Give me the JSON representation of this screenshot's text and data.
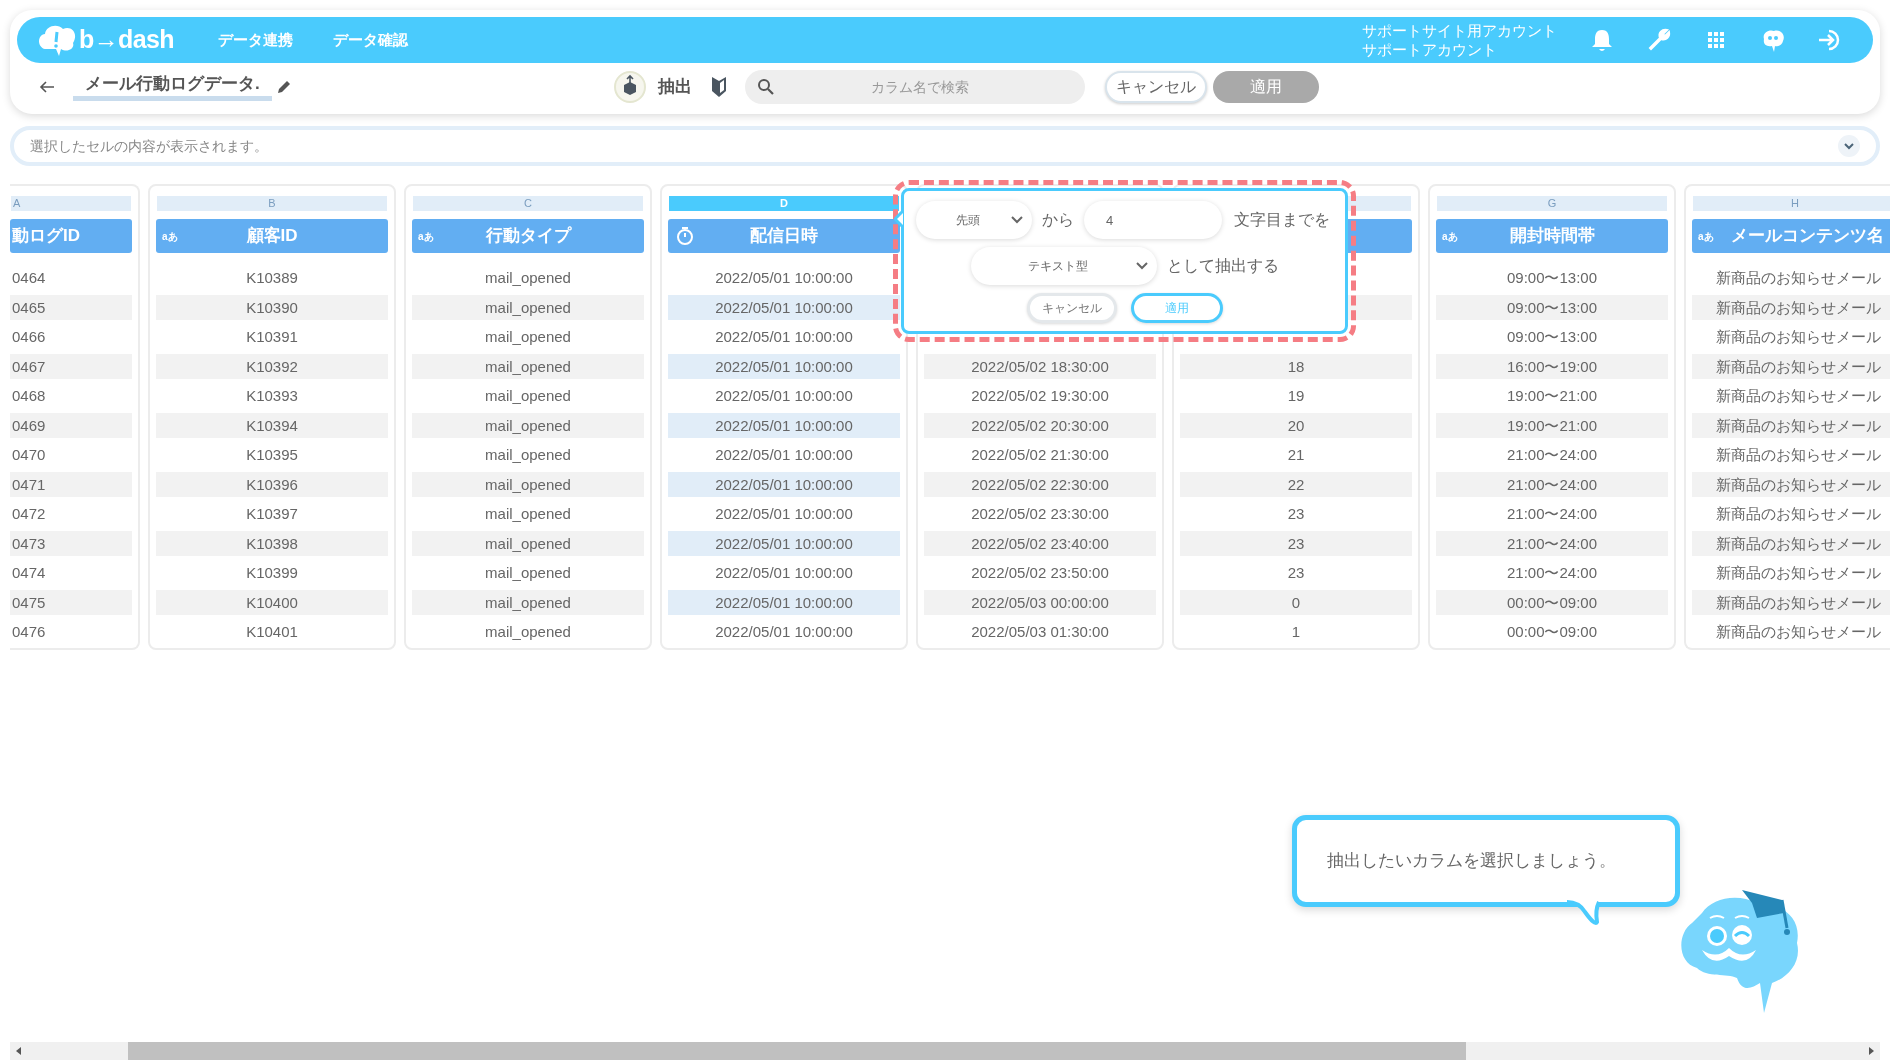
{
  "header": {
    "logo": "b→dash",
    "nav": [
      {
        "label": "データ連携"
      },
      {
        "label": "データ確認"
      }
    ],
    "account": {
      "site": "サポートサイト用アカウント",
      "user": "サポートアカウント"
    }
  },
  "toolbar": {
    "title": "メール行動ログデータ.",
    "extract_label": "抽出",
    "search": {
      "placeholder": "カラム名で検索"
    },
    "buttons": [
      {
        "label": "キャンセル",
        "disabled": false
      },
      {
        "label": "適用",
        "disabled": true
      }
    ]
  },
  "cell_preview": {
    "placeholder": "選択したセルの内容が表示されます。"
  },
  "columns": [
    {
      "letter": "A",
      "header": "動ログID",
      "kind": "plain",
      "selected": false,
      "cells": [
        "0464",
        "0465",
        "0466",
        "0467",
        "0468",
        "0469",
        "0470",
        "0471",
        "0472",
        "0473",
        "0474",
        "0475",
        "0476"
      ]
    },
    {
      "letter": "B",
      "header": "顧客ID",
      "kind": "text",
      "type_label": "aあ",
      "selected": false,
      "cells": [
        "K10389",
        "K10390",
        "K10391",
        "K10392",
        "K10393",
        "K10394",
        "K10395",
        "K10396",
        "K10397",
        "K10398",
        "K10399",
        "K10400",
        "K10401"
      ]
    },
    {
      "letter": "C",
      "header": "行動タイプ",
      "kind": "text",
      "type_label": "aあ",
      "selected": false,
      "cells": [
        "mail_opened",
        "mail_opened",
        "mail_opened",
        "mail_opened",
        "mail_opened",
        "mail_opened",
        "mail_opened",
        "mail_opened",
        "mail_opened",
        "mail_opened",
        "mail_opened",
        "mail_opened",
        "mail_opened"
      ]
    },
    {
      "letter": "D",
      "header": "配信日時",
      "kind": "datetime",
      "selected": true,
      "cells": [
        "2022/05/01 10:00:00",
        "2022/05/01 10:00:00",
        "2022/05/01 10:00:00",
        "2022/05/01 10:00:00",
        "2022/05/01 10:00:00",
        "2022/05/01 10:00:00",
        "2022/05/01 10:00:00",
        "2022/05/01 10:00:00",
        "2022/05/01 10:00:00",
        "2022/05/01 10:00:00",
        "2022/05/01 10:00:00",
        "2022/05/01 10:00:00",
        "2022/05/01 10:00:00"
      ]
    },
    {
      "kind": "covered",
      "cells": [
        null,
        null,
        null,
        "2022/05/02 18:30:00",
        "2022/05/02 19:30:00",
        "2022/05/02 20:30:00",
        "2022/05/02 21:30:00",
        "2022/05/02 22:30:00",
        "2022/05/02 23:30:00",
        "2022/05/02 23:40:00",
        "2022/05/02 23:50:00",
        "2022/05/03 00:00:00",
        "2022/05/03 01:30:00"
      ]
    },
    {
      "kind": "covered",
      "cells": [
        null,
        null,
        null,
        "18",
        "19",
        "20",
        "21",
        "22",
        "23",
        "23",
        "23",
        "0",
        "1"
      ]
    },
    {
      "letter": "G",
      "header": "開封時間帯",
      "kind": "text",
      "type_label": "aあ",
      "selected": false,
      "cells": [
        "09:00〜13:00",
        "09:00〜13:00",
        "09:00〜13:00",
        "16:00〜19:00",
        "19:00〜21:00",
        "19:00〜21:00",
        "21:00〜24:00",
        "21:00〜24:00",
        "21:00〜24:00",
        "21:00〜24:00",
        "21:00〜24:00",
        "00:00〜09:00",
        "00:00〜09:00"
      ]
    },
    {
      "letter": "H",
      "header": "メールコンテンツ名",
      "kind": "text",
      "type_label": "aあ",
      "selected": false,
      "cells": [
        "新商品のお知らせメール",
        "新商品のお知らせメール",
        "新商品のお知らせメール",
        "新商品のお知らせメール",
        "新商品のお知らせメール",
        "新商品のお知らせメール",
        "新商品のお知らせメール",
        "新商品のお知らせメール",
        "新商品のお知らせメール",
        "新商品のお知らせメール",
        "新商品のお知らせメール",
        "新商品のお知らせメール",
        "新商品のお知らせメール"
      ]
    }
  ],
  "popup": {
    "start_select": "先頭",
    "from_label": "から",
    "count_value": "4",
    "until_label": "文字目までを",
    "type_select": "テキスト型",
    "as_label": "として抽出する",
    "buttons": [
      {
        "label": "キャンセル",
        "kind": "secondary"
      },
      {
        "label": "適用",
        "kind": "primary"
      }
    ]
  },
  "tooltip": {
    "text": "抽出したいカラムを選択しましょう。"
  }
}
